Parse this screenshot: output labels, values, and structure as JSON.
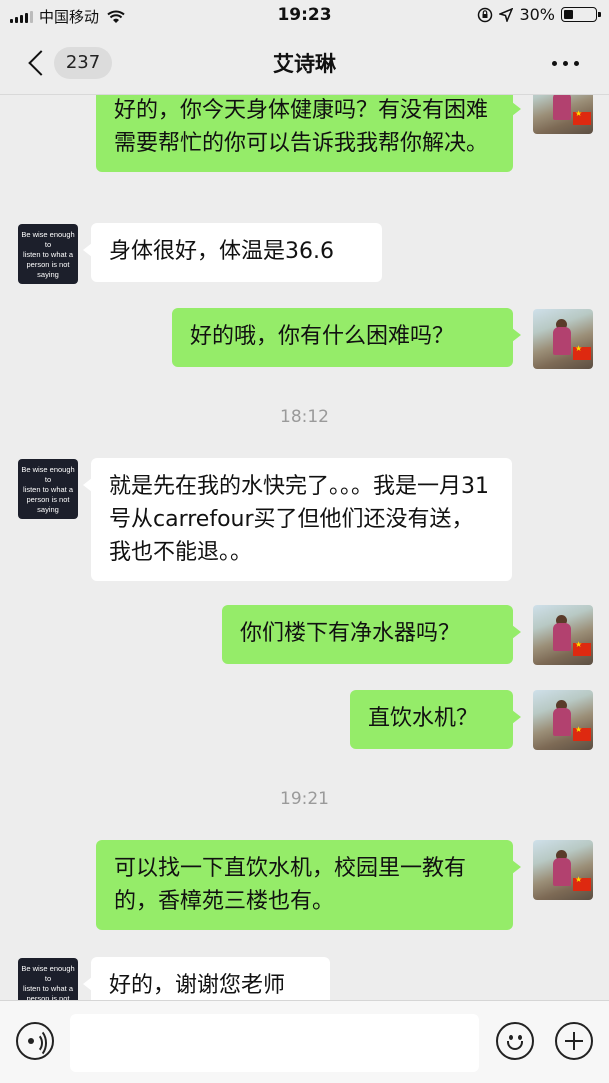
{
  "status_bar": {
    "carrier": "中国移动",
    "time": "19:23",
    "battery_percent": "30%",
    "battery_level": 0.3
  },
  "nav": {
    "back_badge": "237",
    "title": "艾诗琳",
    "more_icon": "more-dots-icon"
  },
  "avatars": {
    "contact_text": [
      "Be wise enough to",
      "listen to what a",
      "person is not",
      "saying"
    ]
  },
  "messages": [
    {
      "sender": "me",
      "text": "好的，你今天身体健康吗？有没有困难需要帮忙的你可以告诉我我帮你解决。"
    },
    {
      "sender": "them",
      "text": "身体很好，体温是36.6"
    },
    {
      "sender": "me",
      "text": "好的哦，你有什么困难吗？"
    },
    {
      "type": "time",
      "text": "18:12"
    },
    {
      "sender": "them",
      "text": "就是先在我的水快完了。。。我是一月31号从carrefour买了但他们还没有送，我也不能退。。"
    },
    {
      "sender": "me",
      "text": "你们楼下有净水器吗？"
    },
    {
      "sender": "me",
      "text": "直饮水机？"
    },
    {
      "type": "time",
      "text": "19:21"
    },
    {
      "sender": "me",
      "text": "可以找一下直饮水机，校园里一教有的，香樟苑三楼也有。"
    },
    {
      "sender": "them",
      "text": "好的，谢谢您老师"
    }
  ],
  "input_bar": {
    "input_value": "",
    "voice_icon": "voice-icon",
    "emoji_icon": "emoji-icon",
    "plus_icon": "plus-icon"
  }
}
